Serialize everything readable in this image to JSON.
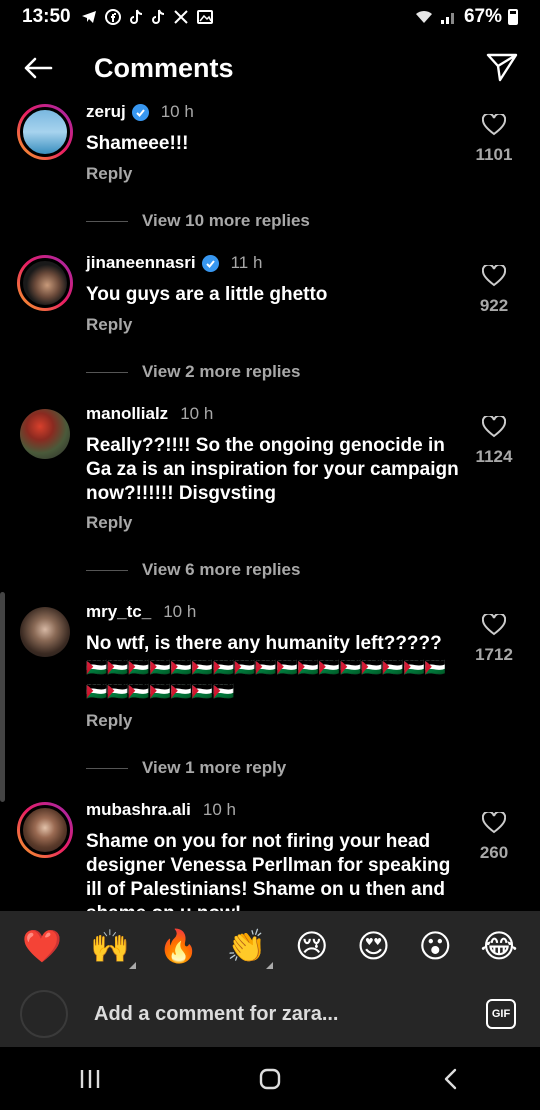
{
  "status_bar": {
    "time": "13:50",
    "battery": "67%",
    "notification_icons": [
      "telegram-icon",
      "facebook-icon",
      "tiktok-icon",
      "tiktok-icon",
      "x-icon",
      "gallery-icon"
    ]
  },
  "header": {
    "title": "Comments"
  },
  "comments": [
    {
      "username": "zeruj",
      "verified": true,
      "time": "10 h",
      "text": "Shameee!!!",
      "likes": "1101",
      "reply": "Reply",
      "more_replies": "View 10 more replies"
    },
    {
      "username": "jinaneennasri",
      "verified": true,
      "time": "11 h",
      "text": "You guys are a little ghetto",
      "likes": "922",
      "reply": "Reply",
      "more_replies": "View 2 more replies"
    },
    {
      "username": "manollialz",
      "verified": false,
      "time": "10 h",
      "text": "Really??!!!! So the ongoing genocide in Ga za is an inspiration for your campaign now?!!!!!! Disgvsting",
      "likes": "1124",
      "reply": "Reply",
      "more_replies": "View 6 more replies"
    },
    {
      "username": "mry_tc_",
      "verified": false,
      "time": "10 h",
      "text": "No wtf, is there any humanity left?????",
      "flags": "🇵🇸🇵🇸🇵🇸🇵🇸🇵🇸🇵🇸🇵🇸🇵🇸🇵🇸🇵🇸🇵🇸🇵🇸🇵🇸🇵🇸🇵🇸🇵🇸🇵🇸🇵🇸🇵🇸🇵🇸🇵🇸🇵🇸🇵🇸🇵🇸",
      "likes": "1712",
      "reply": "Reply",
      "more_replies": "View 1 more reply"
    },
    {
      "username": "mubashra.ali",
      "verified": false,
      "time": "10 h",
      "text": "Shame on you for not firing  your head designer Venessa Perllman for speaking ill of Palestinians! Shame on u then and shame on u now!",
      "likes": "260"
    }
  ],
  "emoji_bar": [
    "❤️",
    "🙌",
    "🔥",
    "👏",
    "😢",
    "😍",
    "😮",
    "😂"
  ],
  "comment_input": {
    "placeholder": "Add a comment for zara..."
  },
  "gif_label": "GIF",
  "nav": [
    "recent-apps-icon",
    "home-icon",
    "back-icon"
  ]
}
